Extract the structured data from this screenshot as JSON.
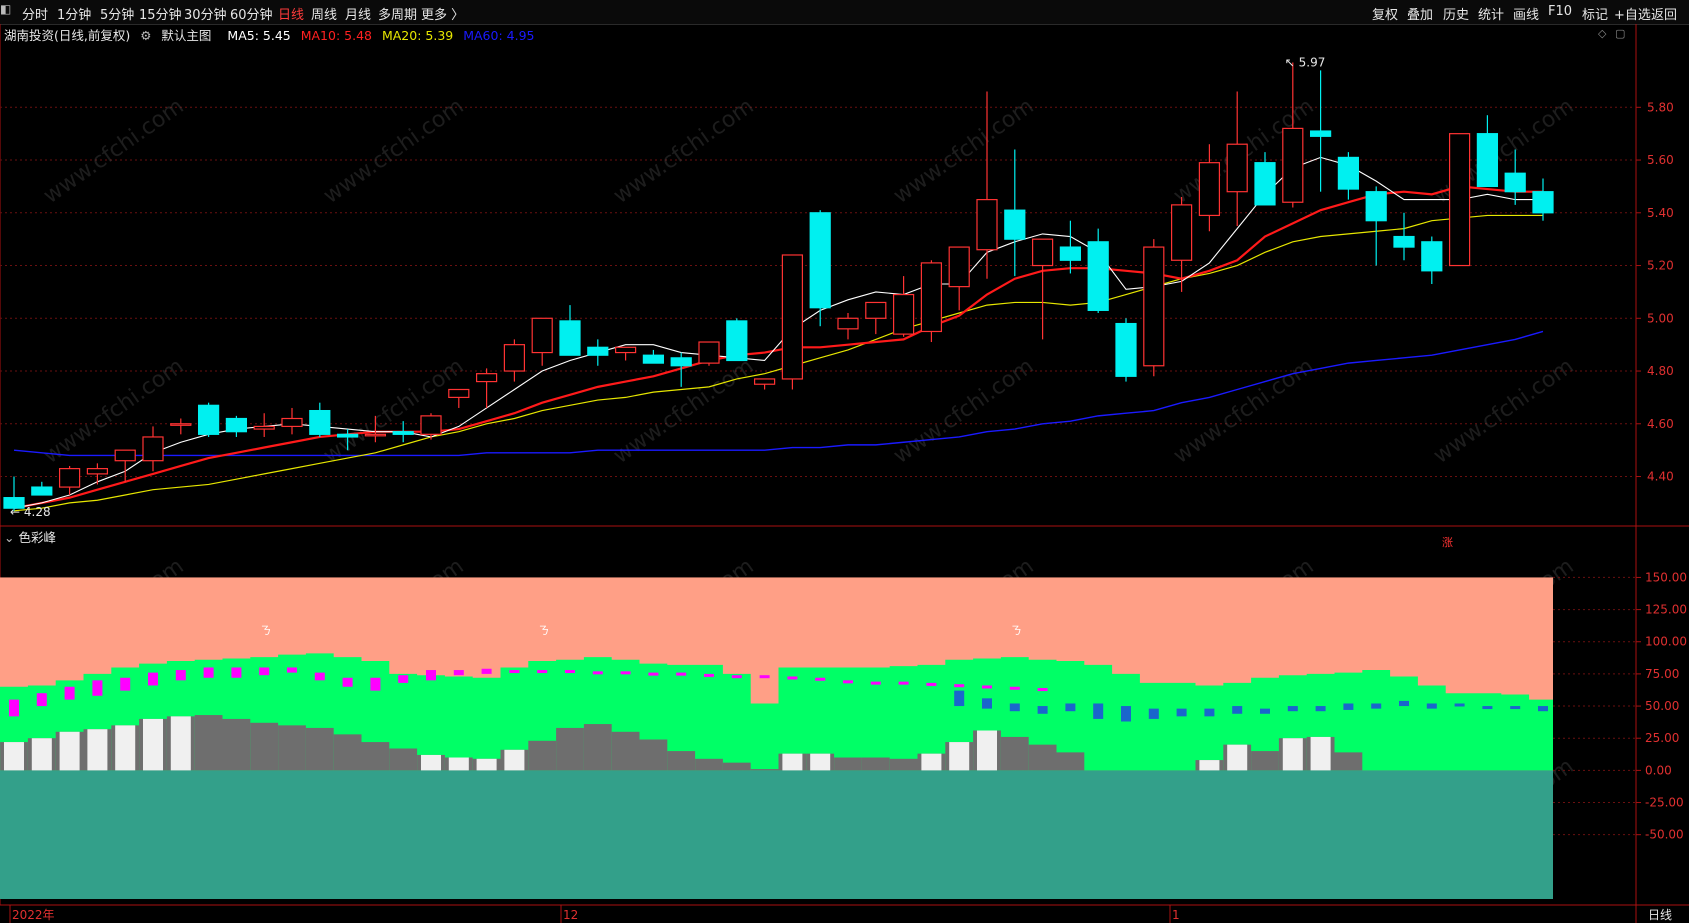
{
  "toolbar": {
    "left": [
      "分时",
      "1分钟",
      "5分钟",
      "15分钟",
      "30分钟",
      "60分钟",
      "日线",
      "周线",
      "月线",
      "多周期",
      "更多 〉"
    ],
    "active": "日线",
    "right": [
      "复权",
      "叠加",
      "历史",
      "统计",
      "画线",
      "F10",
      "标记",
      "+自选",
      "返回"
    ]
  },
  "main_legend": {
    "title": "湖南投资(日线,前复权)",
    "template": "默认主图",
    "ma5": "MA5: 5.45",
    "ma10": "MA10: 5.48",
    "ma20": "MA20: 5.39",
    "ma60": "MA60: 4.95",
    "colors": {
      "ma5": "#ffffff",
      "ma10": "#ff2020",
      "ma20": "#e6e600",
      "ma60": "#1a1aff",
      "title": "#e6e6e6"
    }
  },
  "sub_legend": {
    "title": "色彩峰"
  },
  "annotations": {
    "high": "5.97",
    "low": "4.28",
    "marker": "涨",
    "top_mark": "ㄋ"
  },
  "watermark": "www.cfchi.com",
  "axis": {
    "price_ticks": [
      "5.80",
      "5.60",
      "5.40",
      "5.20",
      "5.00",
      "4.80",
      "4.60",
      "4.40"
    ],
    "ind_ticks": [
      "150.00",
      "125.00",
      "100.00",
      "75.00",
      "50.00",
      "25.00",
      "0.00",
      "-25.00",
      "-50.00"
    ],
    "date_labels": [
      "2022年",
      "12",
      "1"
    ],
    "period_label": "日线"
  },
  "chart_data": {
    "type": "candlestick",
    "ylim": [
      4.22,
      6.04
    ],
    "candles": [
      [
        4.32,
        4.4,
        4.27,
        4.28
      ],
      [
        4.36,
        4.38,
        4.34,
        4.33
      ],
      [
        4.36,
        4.44,
        4.33,
        4.43
      ],
      [
        4.41,
        4.45,
        4.37,
        4.43
      ],
      [
        4.46,
        4.5,
        4.38,
        4.5
      ],
      [
        4.46,
        4.59,
        4.42,
        4.55
      ],
      [
        4.6,
        4.62,
        4.56,
        4.6
      ],
      [
        4.67,
        4.68,
        4.55,
        4.56
      ],
      [
        4.62,
        4.63,
        4.55,
        4.57
      ],
      [
        4.58,
        4.64,
        4.55,
        4.59
      ],
      [
        4.59,
        4.66,
        4.56,
        4.62
      ],
      [
        4.65,
        4.68,
        4.55,
        4.56
      ],
      [
        4.56,
        4.58,
        4.5,
        4.55
      ],
      [
        4.56,
        4.63,
        4.53,
        4.56
      ],
      [
        4.57,
        4.61,
        4.53,
        4.56
      ],
      [
        4.56,
        4.64,
        4.54,
        4.63
      ],
      [
        4.7,
        4.73,
        4.66,
        4.73
      ],
      [
        4.76,
        4.81,
        4.66,
        4.79
      ],
      [
        4.8,
        4.92,
        4.76,
        4.9
      ],
      [
        4.87,
        5.0,
        4.82,
        5.0
      ],
      [
        4.99,
        5.05,
        4.86,
        4.86
      ],
      [
        4.89,
        4.92,
        4.82,
        4.86
      ],
      [
        4.87,
        4.88,
        4.84,
        4.89
      ],
      [
        4.86,
        4.88,
        4.84,
        4.83
      ],
      [
        4.85,
        4.87,
        4.74,
        4.82
      ],
      [
        4.83,
        4.89,
        4.82,
        4.91
      ],
      [
        4.99,
        5.0,
        4.84,
        4.84
      ],
      [
        4.75,
        4.77,
        4.73,
        4.77
      ],
      [
        4.77,
        5.13,
        4.73,
        5.24
      ],
      [
        5.4,
        5.41,
        4.97,
        5.04
      ],
      [
        4.96,
        5.02,
        4.92,
        5.0
      ],
      [
        5.0,
        5.06,
        4.94,
        5.06
      ],
      [
        4.94,
        5.16,
        4.93,
        5.09
      ],
      [
        4.95,
        5.22,
        4.91,
        5.21
      ],
      [
        5.12,
        5.27,
        5.03,
        5.27
      ],
      [
        5.26,
        5.86,
        5.15,
        5.45
      ],
      [
        5.41,
        5.64,
        5.16,
        5.3
      ],
      [
        5.2,
        5.3,
        4.92,
        5.3
      ],
      [
        5.27,
        5.37,
        5.17,
        5.22
      ],
      [
        5.29,
        5.34,
        5.02,
        5.03
      ],
      [
        4.98,
        5.0,
        4.76,
        4.78
      ],
      [
        4.82,
        5.3,
        4.78,
        5.27
      ],
      [
        5.22,
        5.46,
        5.1,
        5.43
      ],
      [
        5.39,
        5.66,
        5.33,
        5.59
      ],
      [
        5.48,
        5.86,
        5.35,
        5.66
      ],
      [
        5.59,
        5.63,
        5.43,
        5.43
      ],
      [
        5.44,
        5.97,
        5.42,
        5.72
      ],
      [
        5.71,
        5.94,
        5.48,
        5.69
      ],
      [
        5.61,
        5.63,
        5.45,
        5.49
      ],
      [
        5.48,
        5.5,
        5.2,
        5.37
      ],
      [
        5.31,
        5.4,
        5.22,
        5.27
      ],
      [
        5.29,
        5.31,
        5.13,
        5.18
      ],
      [
        5.2,
        5.64,
        5.2,
        5.7
      ],
      [
        5.7,
        5.77,
        5.5,
        5.5
      ],
      [
        5.55,
        5.64,
        5.43,
        5.48
      ],
      [
        5.48,
        5.53,
        5.37,
        5.4
      ]
    ],
    "ma5": [
      4.28,
      4.3,
      4.33,
      4.38,
      4.42,
      4.49,
      4.53,
      4.56,
      4.58,
      4.59,
      4.6,
      4.59,
      4.58,
      4.57,
      4.57,
      4.55,
      4.59,
      4.66,
      4.73,
      4.8,
      4.84,
      4.87,
      4.9,
      4.9,
      4.87,
      4.86,
      4.85,
      4.84,
      4.96,
      5.03,
      5.07,
      5.1,
      5.09,
      5.13,
      5.13,
      5.25,
      5.29,
      5.32,
      5.31,
      5.25,
      5.11,
      5.12,
      5.14,
      5.21,
      5.34,
      5.47,
      5.57,
      5.61,
      5.58,
      5.52,
      5.45,
      5.45,
      5.45,
      5.47,
      5.45,
      5.45
    ],
    "ma10": [
      4.28,
      4.3,
      4.32,
      4.35,
      4.38,
      4.41,
      4.44,
      4.47,
      4.49,
      4.51,
      4.53,
      4.55,
      4.56,
      4.57,
      4.57,
      4.57,
      4.58,
      4.61,
      4.64,
      4.68,
      4.71,
      4.74,
      4.76,
      4.78,
      4.81,
      4.84,
      4.86,
      4.87,
      4.89,
      4.89,
      4.9,
      4.91,
      4.92,
      4.97,
      5.01,
      5.09,
      5.15,
      5.18,
      5.19,
      5.19,
      5.18,
      5.17,
      5.15,
      5.18,
      5.22,
      5.31,
      5.36,
      5.41,
      5.44,
      5.47,
      5.48,
      5.47,
      5.5,
      5.49,
      5.48,
      5.48
    ],
    "ma20": [
      4.27,
      4.28,
      4.3,
      4.31,
      4.33,
      4.35,
      4.36,
      4.37,
      4.39,
      4.41,
      4.43,
      4.45,
      4.47,
      4.49,
      4.52,
      4.55,
      4.57,
      4.6,
      4.62,
      4.65,
      4.67,
      4.69,
      4.7,
      4.72,
      4.73,
      4.74,
      4.77,
      4.79,
      4.82,
      4.85,
      4.88,
      4.92,
      4.96,
      4.99,
      5.02,
      5.05,
      5.06,
      5.06,
      5.05,
      5.06,
      5.09,
      5.12,
      5.15,
      5.17,
      5.2,
      5.25,
      5.29,
      5.31,
      5.32,
      5.33,
      5.34,
      5.37,
      5.38,
      5.39,
      5.39,
      5.39
    ],
    "ma60": [
      4.5,
      4.49,
      4.48,
      4.48,
      4.48,
      4.48,
      4.48,
      4.48,
      4.48,
      4.48,
      4.48,
      4.48,
      4.48,
      4.48,
      4.48,
      4.48,
      4.48,
      4.49,
      4.49,
      4.49,
      4.49,
      4.5,
      4.5,
      4.5,
      4.5,
      4.5,
      4.5,
      4.5,
      4.51,
      4.51,
      4.52,
      4.52,
      4.53,
      4.54,
      4.55,
      4.57,
      4.58,
      4.6,
      4.61,
      4.63,
      4.64,
      4.65,
      4.68,
      4.7,
      4.73,
      4.76,
      4.79,
      4.81,
      4.83,
      4.84,
      4.85,
      4.86,
      4.88,
      4.9,
      4.92,
      4.95
    ],
    "indicator": {
      "ylim": [
        -100,
        155
      ],
      "salmon_top": 150,
      "teal_bottom": -100,
      "green": [
        65,
        66,
        70,
        75,
        80,
        83,
        85,
        86,
        87,
        88,
        90,
        91,
        88,
        85,
        75,
        74,
        73,
        72,
        80,
        85,
        86,
        88,
        86,
        83,
        82,
        82,
        75,
        52,
        80,
        80,
        80,
        80,
        81,
        82,
        86,
        87,
        88,
        86,
        85,
        82,
        75,
        68,
        68,
        66,
        68,
        72,
        74,
        75,
        76,
        78,
        73,
        66,
        60,
        60,
        59,
        55
      ],
      "grey": [
        22,
        25,
        30,
        32,
        35,
        40,
        42,
        43,
        40,
        37,
        35,
        33,
        28,
        22,
        17,
        12,
        10,
        9,
        16,
        23,
        33,
        36,
        30,
        24,
        15,
        9,
        6,
        1,
        13,
        13,
        10,
        10,
        9,
        13,
        22,
        31,
        26,
        20,
        14,
        0,
        0,
        0,
        0,
        8,
        20,
        15,
        25,
        26,
        14,
        0,
        0,
        0,
        0,
        0,
        0,
        0
      ],
      "white_bars": [
        1,
        1,
        1,
        1,
        1,
        1,
        1,
        0,
        0,
        0,
        0,
        0,
        0,
        0,
        0,
        1,
        1,
        1,
        1,
        0,
        0,
        0,
        0,
        0,
        0,
        0,
        0,
        0,
        1,
        1,
        0,
        0,
        0,
        1,
        1,
        1,
        0,
        0,
        0,
        0,
        0,
        0,
        0,
        1,
        1,
        0,
        1,
        1,
        0,
        0,
        0,
        0,
        0,
        0,
        0,
        0
      ],
      "magenta": [
        [
          42,
          55
        ],
        [
          50,
          60
        ],
        [
          55,
          65
        ],
        [
          58,
          70
        ],
        [
          62,
          72
        ],
        [
          66,
          76
        ],
        [
          70,
          78
        ],
        [
          72,
          80
        ],
        [
          72,
          80
        ],
        [
          74,
          80
        ],
        [
          76,
          80
        ],
        [
          70,
          76
        ],
        [
          65,
          72
        ],
        [
          62,
          72
        ],
        [
          68,
          74
        ],
        [
          70,
          78
        ],
        [
          74,
          78
        ],
        [
          75,
          79
        ],
        [
          77,
          78
        ],
        [
          77,
          78
        ],
        [
          77,
          78
        ],
        [
          77,
          77
        ],
        [
          76,
          77
        ],
        [
          75,
          76
        ],
        [
          75,
          76
        ],
        [
          74,
          75
        ],
        [
          74,
          74
        ],
        [
          73,
          74
        ],
        [
          71,
          73
        ],
        [
          70,
          72
        ],
        [
          69,
          70
        ],
        [
          68,
          69
        ],
        [
          68,
          69
        ],
        [
          67,
          68
        ],
        [
          66,
          67
        ],
        [
          65,
          66
        ],
        [
          64,
          65
        ],
        [
          63,
          64
        ]
      ],
      "blue": [
        [
          50,
          62
        ],
        [
          48,
          56
        ],
        [
          46,
          52
        ],
        [
          44,
          50
        ],
        [
          46,
          52
        ],
        [
          40,
          52
        ],
        [
          38,
          50
        ],
        [
          40,
          48
        ],
        [
          42,
          48
        ],
        [
          42,
          48
        ],
        [
          44,
          50
        ],
        [
          44,
          48
        ],
        [
          46,
          50
        ],
        [
          46,
          50
        ],
        [
          47,
          52
        ],
        [
          48,
          52
        ],
        [
          50,
          54
        ],
        [
          48,
          52
        ],
        [
          50,
          52
        ],
        [
          48,
          50
        ],
        [
          48,
          50
        ],
        [
          46,
          50
        ]
      ],
      "tick_labels": [
        "150.00",
        "125.00",
        "100.00",
        "75.00",
        "50.00",
        "25.00",
        "0.00",
        "-25.00",
        "-50.00"
      ]
    }
  }
}
